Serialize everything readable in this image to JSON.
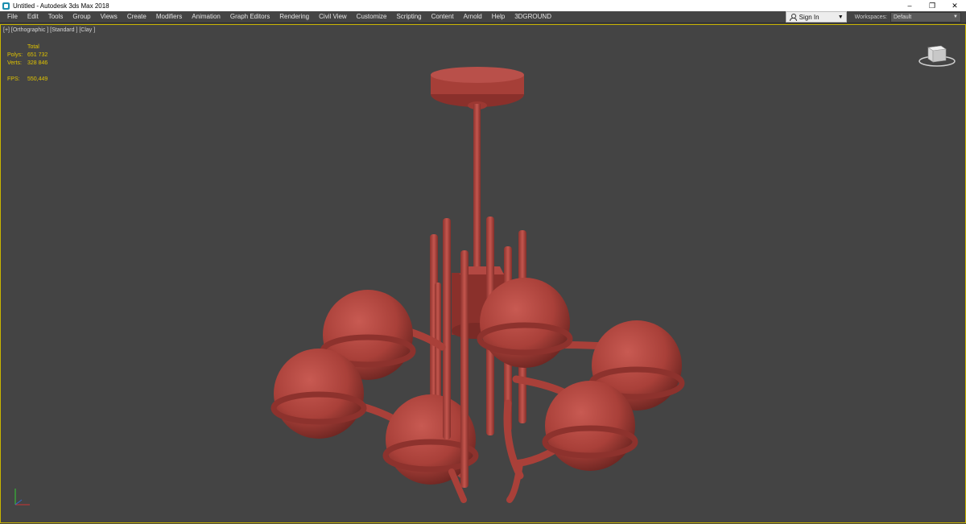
{
  "window": {
    "title": "Untitled - Autodesk 3ds Max 2018",
    "controls": [
      "minimize",
      "restore",
      "close"
    ]
  },
  "menubar": {
    "items": [
      "File",
      "Edit",
      "Tools",
      "Group",
      "Views",
      "Create",
      "Modifiers",
      "Animation",
      "Graph Editors",
      "Rendering",
      "Civil View",
      "Customize",
      "Scripting",
      "Content",
      "Arnold",
      "Help",
      "3DGROUND"
    ],
    "sign_in": "Sign In",
    "workspaces_label": "Workspaces:",
    "workspaces_value": "Default"
  },
  "viewport": {
    "label": "[+] [Orthographic ] [Standard ] [Clay ]",
    "stats": {
      "total_label": "Total",
      "polys_label": "Polys:",
      "polys_value": "651 732",
      "verts_label": "Verts:",
      "verts_value": "328 846",
      "fps_label": "FPS:",
      "fps_value": "550,449"
    }
  },
  "colors": {
    "model": "#b34842",
    "viewport_bg": "#444444",
    "active_border": "#c8b400",
    "stats_text": "#e0c300"
  },
  "icons": [
    "app-icon",
    "user-icon",
    "viewcube-icon",
    "axis-triad-icon"
  ]
}
